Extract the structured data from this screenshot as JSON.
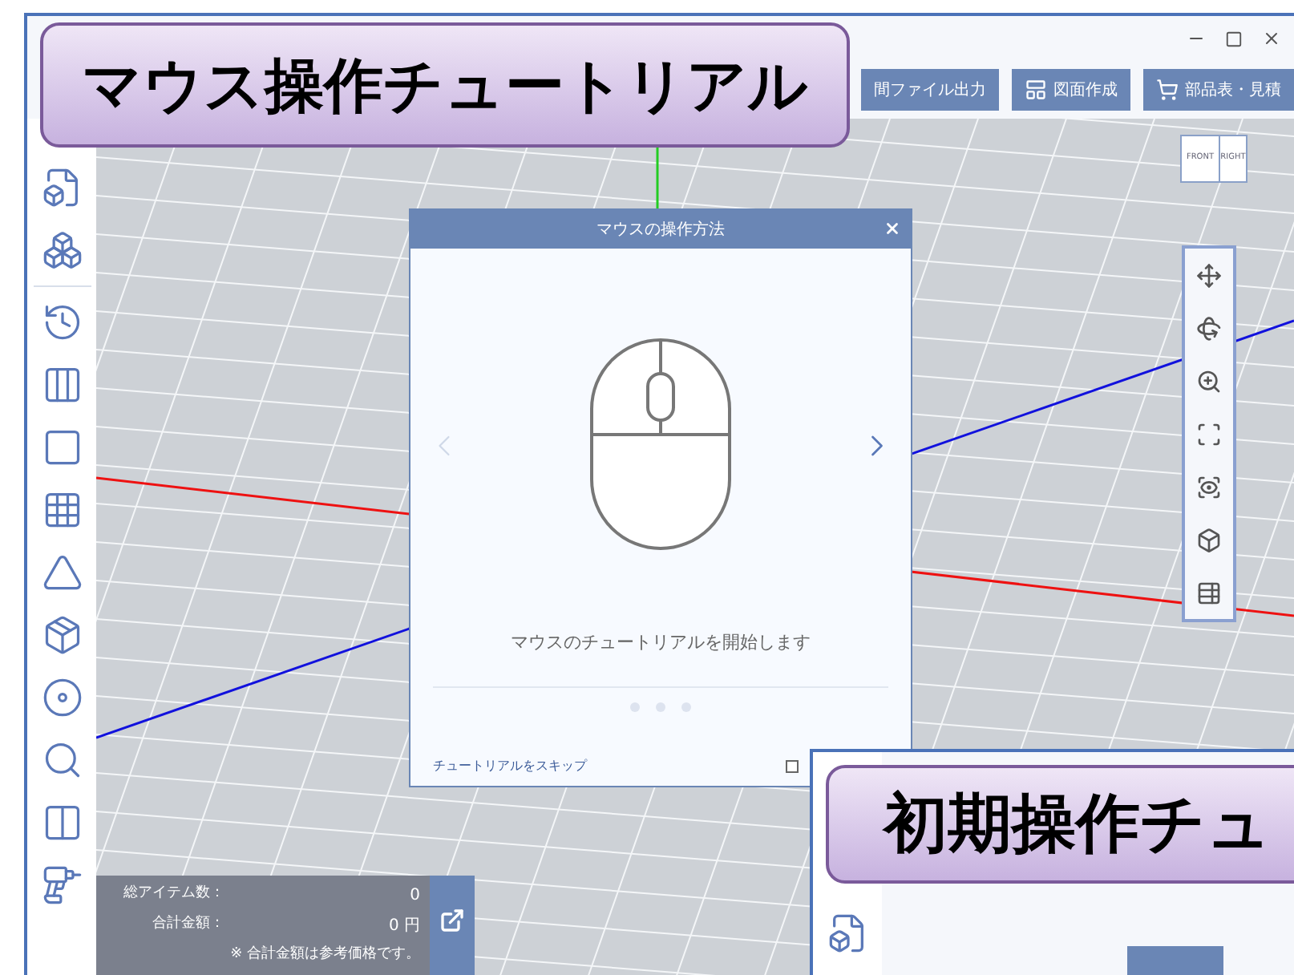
{
  "overlay_label": {
    "text": "マウス操作チュートリアル"
  },
  "toolbar": {
    "buttons": [
      {
        "label": "間ファイル出力"
      },
      {
        "label": "図面作成"
      },
      {
        "label": "部品表・見積"
      }
    ]
  },
  "view_cube": {
    "front": "FRONT",
    "right": "RIGHT"
  },
  "dialog": {
    "title": "マウスの操作方法",
    "message": "マウスのチュートリアルを開始します",
    "skip_link": "チュートリアルをスキップ",
    "checkbox": {
      "checked": false
    }
  },
  "summary": {
    "rows": [
      {
        "label": "総アイテム数：",
        "value": "0"
      },
      {
        "label": "合計金額：",
        "value": "0 円"
      }
    ],
    "note": "※ 合計金額は参考価格です。"
  },
  "second_window": {
    "overlay_label": "初期操作チュ"
  }
}
